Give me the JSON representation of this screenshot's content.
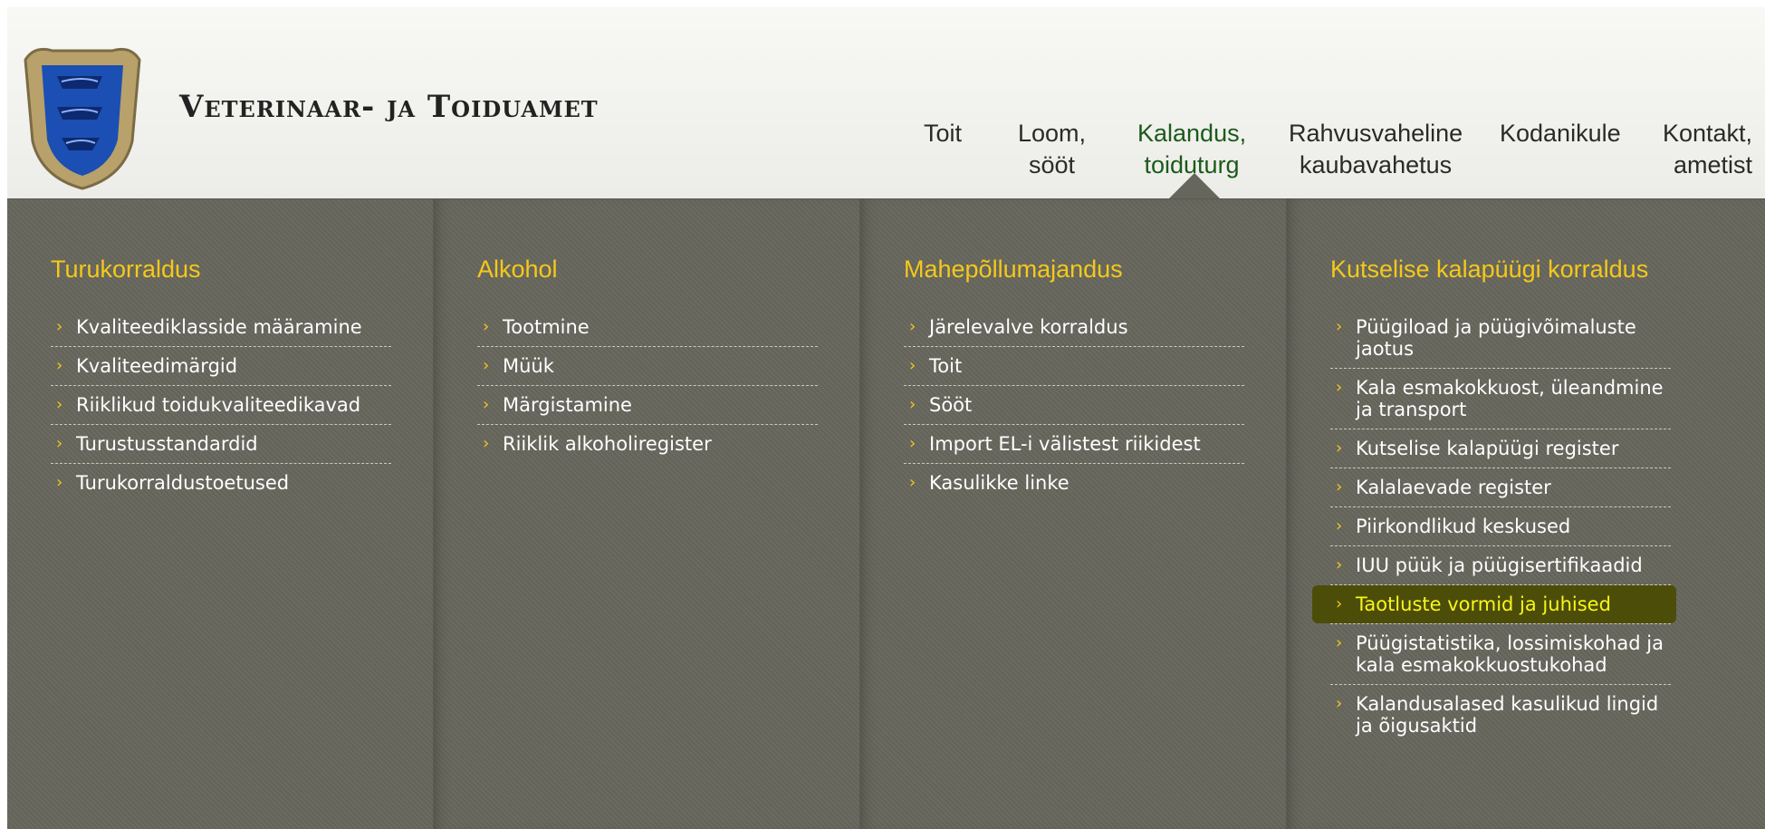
{
  "site": {
    "title": "Veterinaar- ja Toiduamet"
  },
  "colors": {
    "accent": "#f5c81b",
    "panel": "#66665c",
    "highlight": "#f2f21a"
  },
  "nav": [
    {
      "lines": [
        "Toit"
      ]
    },
    {
      "lines": [
        "Loom,",
        "sööt"
      ]
    },
    {
      "lines": [
        "Kalandus,",
        "toiduturg"
      ],
      "active": true
    },
    {
      "lines": [
        "Rahvusvaheline",
        "kaubavahetus"
      ]
    },
    {
      "lines": [
        "Kodanikule"
      ]
    },
    {
      "lines": [
        "Kontakt,",
        "ametist"
      ]
    }
  ],
  "menu": {
    "columns": [
      {
        "title": "Turukorraldus",
        "items": [
          "Kvaliteediklasside määramine",
          "Kvaliteedimärgid",
          "Riiklikud toidukvaliteedikavad",
          "Turustusstandardid",
          "Turukorraldustoetused"
        ]
      },
      {
        "title": "Alkohol",
        "items": [
          "Tootmine",
          "Müük",
          "Märgistamine",
          "Riiklik alkoholiregister"
        ]
      },
      {
        "title": "Mahepõllumajandus",
        "items": [
          "Järelevalve korraldus",
          "Toit",
          "Sööt",
          "Import EL-i välistest riikidest",
          "Kasulikke linke"
        ]
      },
      {
        "title": "Kutselise kalapüügi korraldus",
        "items": [
          "Püügiload ja püügivõimaluste jaotus",
          "Kala esmakokkuost, üleandmine ja transport",
          "Kutselise kalapüügi register",
          "Kalalaevade register",
          "Piirkondlikud keskused",
          "IUU püük ja püügisertifikaadid",
          "Taotluste vormid ja juhised",
          "Püügistatistika, lossimiskohad ja kala esmakokkuostukohad",
          "Kalandusalased kasulikud lingid ja õigusaktid"
        ],
        "highlighted_index": 6
      }
    ]
  }
}
